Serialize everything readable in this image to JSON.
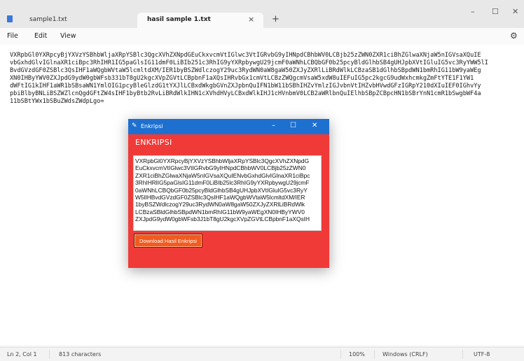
{
  "tabs": [
    {
      "label": "sample1.txt"
    },
    {
      "label": "hasil sample 1.txt"
    }
  ],
  "tab_close_glyph": "×",
  "tab_add_glyph": "+",
  "window_controls": {
    "minimize": "–",
    "maximize": "☐",
    "close": "✕"
  },
  "menu": [
    "File",
    "Edit",
    "View"
  ],
  "settings_icon": "gear-icon",
  "editor_lines": [
    "VXRpbGl0YXRpcyBjYXVzYSBhbWljaXRpYSBlc3QgcXVhZXNpdGEuCkxvcmVtIGlwc3VtIGRvbG9yIHNpdCBhbWV0LCBjb25zZWN0ZXR1ciBhZGlwaXNjaW5nIGVsaXQuIE",
    "vbGxhdGlvIGlnaXR1ciBpc3RhIHR1IG5paGlsIG11dmF0LiBIb251c3RhIG9yYXRpbywgU29jcmF0aWNhLCBQbGF0b25pcyBldGlhbSB4gUHJpbXVtIGluIG5vc3RyYWW5lI",
    "BvdGVzdGF0ZSBlc3QsIHF1aWQgbWVtaW5lcmltdXM/IER1byBSZWdlczogY29uc3RydWN0aW8gaW50ZXJyZXRlLiBRdWlkLCBzaSB1dGlhbSBpdWN1bmRhIG11bW9yaWEg",
    "XN0IHByYWV0ZXJpdG9ydW0gbWFsb331bT8gU2kgcXVpZGVtLCBpbnF1aXQsIHRvbGx1cmVtLCBzZWQgcmVsaW5xdW8uIEFuIG5pc2kgcG9udWxhcmkgZmFtYTE1F1YW1",
    "dWFtIG1kIHF1aWR1bSBsaWN1YmlOIG1pcyBleGlzdG1tYXJlLCBxdWkgbGVnZXJpbnQuIFN1bW11bSBhIHZvYmlzIGJvbnVtIHZvbHVwdGFzIGRpY210dXIuIEF0IGhvYy",
    "pbiBlbyBNLiBSZWZlcnQgdGFtZW4sIHF1byBtb2RvLiBRdWlkIHN1cXVhdHVyLCBxdWlkIHJ1cHVnbmV0LCB2aWRlbnQuIElhbSBpZCBpcHN1bSBrYnN1cmR1bSwgbWF4a",
    "11bSBtYWx1bSBuZWdsZWdpLgo="
  ],
  "status": {
    "position": "Ln 2, Col 1",
    "characters": "813 characters",
    "zoom": "100%",
    "line_ending": "Windows (CRLF)",
    "encoding": "UTF-8"
  },
  "dialog": {
    "title": "Enkripsi",
    "heading": "ENKRIPSI",
    "cipher_lines": [
      "VXRpbGl0YXRpcyBjYXVzYSBhbWljaXRpYSBlc3QgcXVhZXNpdG",
      "EuCkxvcmVtIGlwc3VtIGRvbG9yIHNpdCBhbWV0LCBjb25zZWN0",
      "ZXR1ciBhZGlwaXNjaW5nIGVsaXQuIENvbGxhdGlvIGlnaXR1ciBpc",
      "3RhIHRlIG5paGlsIG11dmF0LiBIb25lc3RhIG9yYXRpbywgU29jcmF",
      "0aWNhLCBQbGF0b25pcyBldGlhbSB4gUHJpbXVtIGluIG5vc3RyY",
      "W5lIHBvdGVzdGF0ZSBlc3QsIHF1aWQgbWVtaW5lcmltdXM/IER",
      "1byBSZWdlczogY29uc3RydWN0aW8gaW50ZXJyZXRlLiBRdWlk",
      "LCBzaSBldGlhbSBpdWN1bmRhIG11bW9yaWEgXN0IHByYWV0",
      "ZXJpdG9ydW0gbWFsb3J1bT8gU2kgcXVpZGVtLCBpbnF1aXQsIH"
    ],
    "download_button": "Download Hasil Enkripsi",
    "controls": {
      "minimize": "–",
      "maximize": "☐",
      "close": "✕"
    }
  },
  "colors": {
    "dialog_bg": "#f03a37",
    "dialog_titlebar": "#1e70d0",
    "download_button_bg": "#f25a1f"
  }
}
